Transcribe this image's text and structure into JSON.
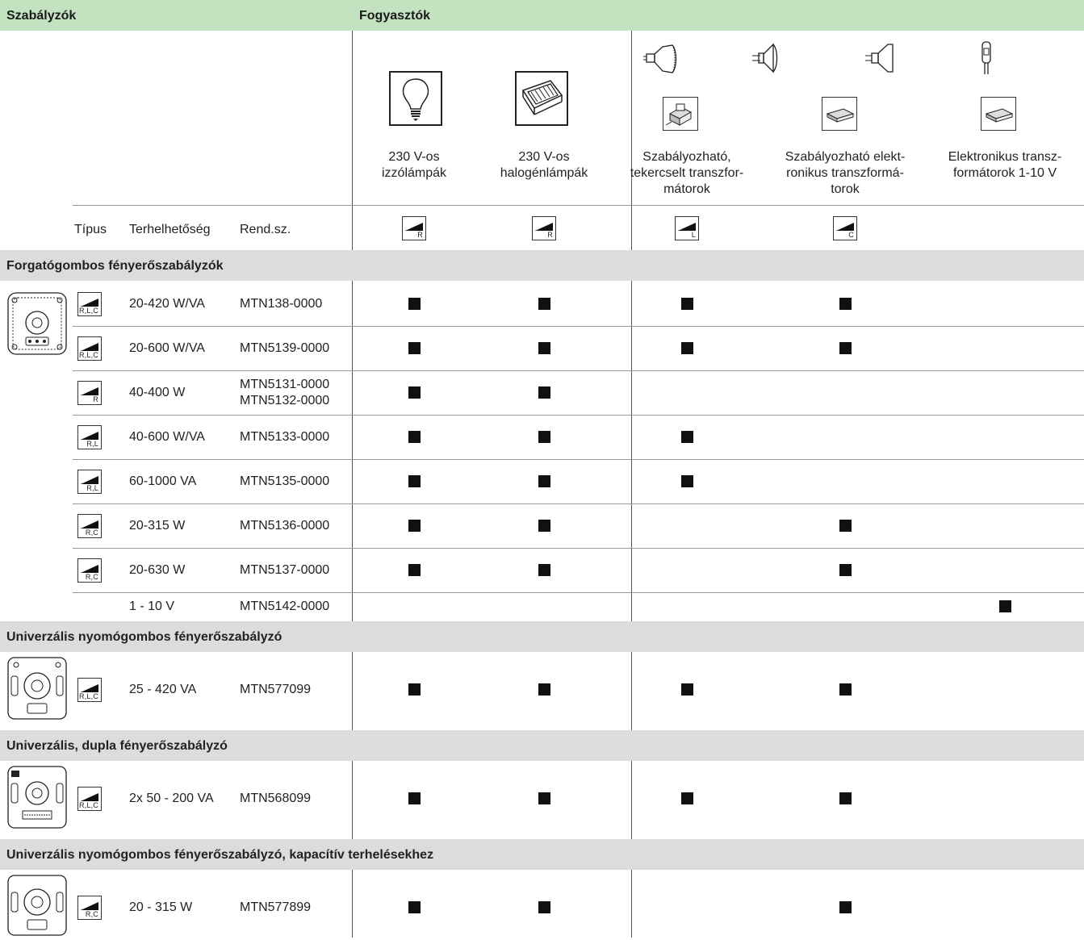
{
  "header": {
    "regulators": "Szabályzók",
    "consumers": "Fogyasztók"
  },
  "categories": [
    {
      "line1": "230 V-os",
      "line2": "izzólámpák",
      "line3": ""
    },
    {
      "line1": "230 V-os",
      "line2": "halogénlámpák",
      "line3": ""
    },
    {
      "line1": "Szabályozható,",
      "line2": "tekercselt transzfor-",
      "line3": "mátorok"
    },
    {
      "line1": "Szabályozható elekt-",
      "line2": "ronikus transzformá-",
      "line3": "torok"
    },
    {
      "line1": "Elektronikus transz-",
      "line2": "formátorok 1-10 V",
      "line3": ""
    }
  ],
  "columns": {
    "type": "Típus",
    "load": "Terhelhetőség",
    "ref": "Rend.sz."
  },
  "category_symbols": [
    "R",
    "R",
    "L",
    "C"
  ],
  "sections": {
    "s1": "Forgatógombos fényerőszabályzók",
    "s2": "Univerzális nyomógombos fényerőszabályzó",
    "s3": "Univerzális, dupla fényerőszabályzó",
    "s4": "Univerzális nyomógombos fényerőszabályzó, kapacítív terhelésekhez"
  },
  "rows": [
    {
      "type": "R,L,C",
      "load": "20-420 W/VA",
      "ref": "MTN138-0000",
      "ref2": ""
    },
    {
      "type": "R,L,C",
      "load": "20-600 W/VA",
      "ref": "MTN5139-0000",
      "ref2": ""
    },
    {
      "type": "R",
      "load": "40-400 W",
      "ref": "MTN5131-0000",
      "ref2": "MTN5132-0000"
    },
    {
      "type": "R,L",
      "load": "40-600 W/VA",
      "ref": "MTN5133-0000",
      "ref2": ""
    },
    {
      "type": "R,L",
      "load": "60-1000 VA",
      "ref": "MTN5135-0000",
      "ref2": ""
    },
    {
      "type": "R,C",
      "load": "20-315 W",
      "ref": "MTN5136-0000",
      "ref2": ""
    },
    {
      "type": "R,C",
      "load": "20-630 W",
      "ref": "MTN5137-0000",
      "ref2": ""
    },
    {
      "type": "",
      "load": "1 - 10 V",
      "ref": "MTN5142-0000",
      "ref2": ""
    },
    {
      "type": "R,L,C",
      "load": "25 - 420 VA",
      "ref": "MTN577099",
      "ref2": ""
    },
    {
      "type": "R,L,C",
      "load": "2x 50 - 200 VA",
      "ref": "MTN568099",
      "ref2": ""
    },
    {
      "type": "R,C",
      "load": "20 - 315 W",
      "ref": "MTN577899",
      "ref2": ""
    }
  ],
  "compatibility": [
    [
      true,
      true,
      true,
      true,
      false
    ],
    [
      true,
      true,
      true,
      true,
      false
    ],
    [
      true,
      true,
      false,
      false,
      false
    ],
    [
      true,
      true,
      true,
      false,
      false
    ],
    [
      true,
      true,
      true,
      false,
      false
    ],
    [
      true,
      true,
      false,
      true,
      false
    ],
    [
      true,
      true,
      false,
      true,
      false
    ],
    [
      false,
      false,
      false,
      false,
      true
    ],
    [
      true,
      true,
      true,
      true,
      false
    ],
    [
      true,
      true,
      true,
      true,
      false
    ],
    [
      true,
      true,
      false,
      true,
      false
    ]
  ],
  "colors": {
    "header_bar": "#c2e2c0",
    "section_bar": "#dcdcdc",
    "marker": "#111111"
  }
}
